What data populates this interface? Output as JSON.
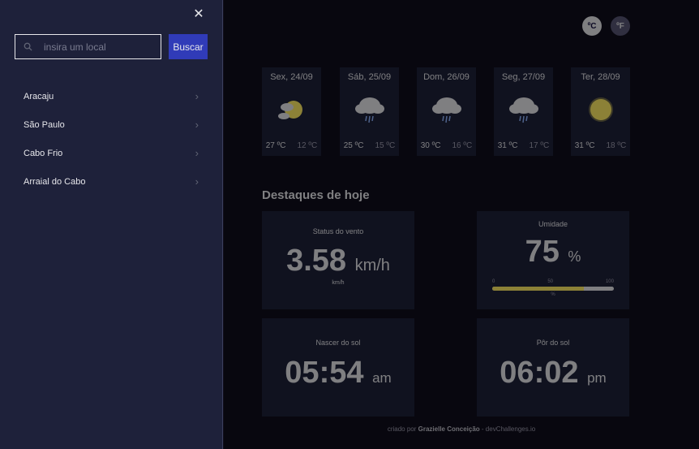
{
  "sidebar": {
    "close_label": "✕",
    "search": {
      "placeholder": "insira um local",
      "value": ""
    },
    "search_button_label": "Buscar",
    "locations": [
      "Aracaju",
      "São Paulo",
      "Cabo Frio",
      "Arraial do Cabo"
    ]
  },
  "units": {
    "celsius": "ºC",
    "fahrenheit": "ºF"
  },
  "forecast": [
    {
      "date": "Sex, 24/09",
      "icon": "partly-cloudy-icon",
      "max": "27 ºC",
      "min": "12 ºC"
    },
    {
      "date": "Sáb, 25/09",
      "icon": "rain-cloud-icon",
      "max": "25 ºC",
      "min": "15 ºC"
    },
    {
      "date": "Dom, 26/09",
      "icon": "rain-cloud-icon",
      "max": "30 ºC",
      "min": "16 ºC"
    },
    {
      "date": "Seg, 27/09",
      "icon": "rain-cloud-icon",
      "max": "31 ºC",
      "min": "17 ºC"
    },
    {
      "date": "Ter, 28/09",
      "icon": "sun-icon",
      "max": "31 ºC",
      "min": "18 ºC"
    }
  ],
  "highlights": {
    "title": "Destaques de hoje",
    "wind": {
      "label": "Status do vento",
      "value": "3.58",
      "unit": "km/h",
      "sub_unit": "km/h"
    },
    "humidity": {
      "label": "Umidade",
      "value": "75",
      "unit": "%",
      "percent": 75,
      "scale": [
        "0",
        "50",
        "100"
      ],
      "scale_unit": "%"
    },
    "sunrise": {
      "label": "Nascer do sol",
      "value": "05:54",
      "unit": "am"
    },
    "sunset": {
      "label": "Pôr do sol",
      "value": "06:02",
      "unit": "pm"
    }
  },
  "footer": {
    "prefix": "criado por",
    "author": "Grazielle Conceição",
    "suffix": "- devChallenges.io"
  },
  "colors": {
    "sun": "#ffec65",
    "cloud": "#e7e7eb",
    "rain": "#91b5ff",
    "accent": "#3c47e9"
  }
}
